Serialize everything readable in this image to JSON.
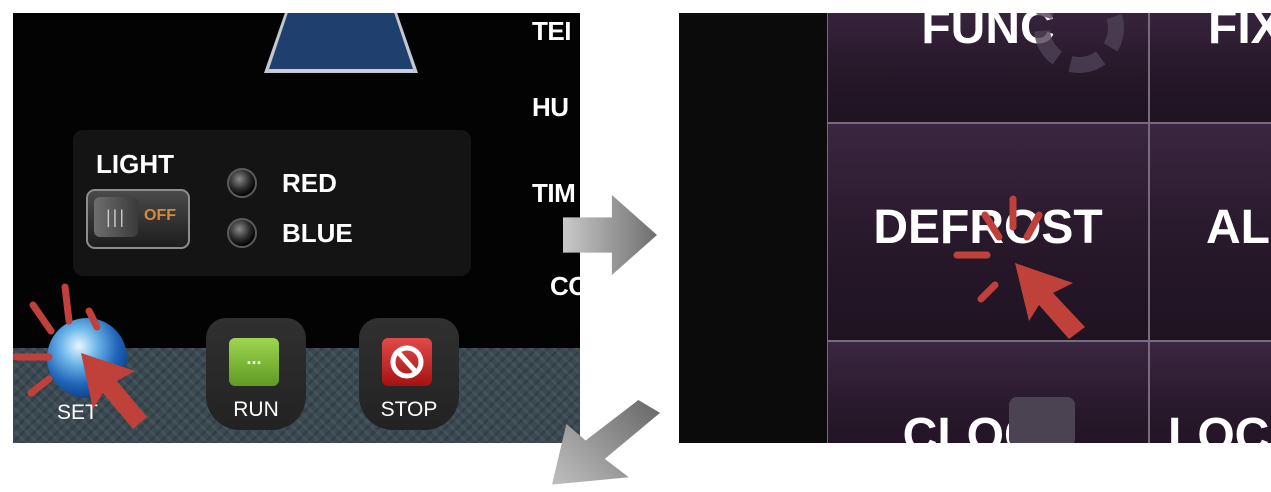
{
  "left_panel": {
    "side_labels": [
      "TEI",
      "HU",
      "TIM",
      "CO"
    ],
    "light": {
      "title": "LIGHT",
      "toggle_state": "OFF",
      "toggle_grip": "|||",
      "leds": [
        {
          "label": "RED"
        },
        {
          "label": "BLUE"
        }
      ]
    },
    "buttons": {
      "set": "SET",
      "run": "RUN",
      "run_icon": "...",
      "stop": "STOP"
    }
  },
  "right_panel": {
    "cells": {
      "top_left": "FUNC",
      "top_right": "FIX",
      "middle_left": "DEFROST",
      "middle_right": "AL",
      "bottom_left": "CLOCK",
      "bottom_right": "LOC"
    }
  },
  "colors": {
    "cursor": "#c0413a",
    "run_button": "#7dbb3a",
    "stop_button": "#c62020",
    "menu_cell": "#2a1a2e"
  }
}
